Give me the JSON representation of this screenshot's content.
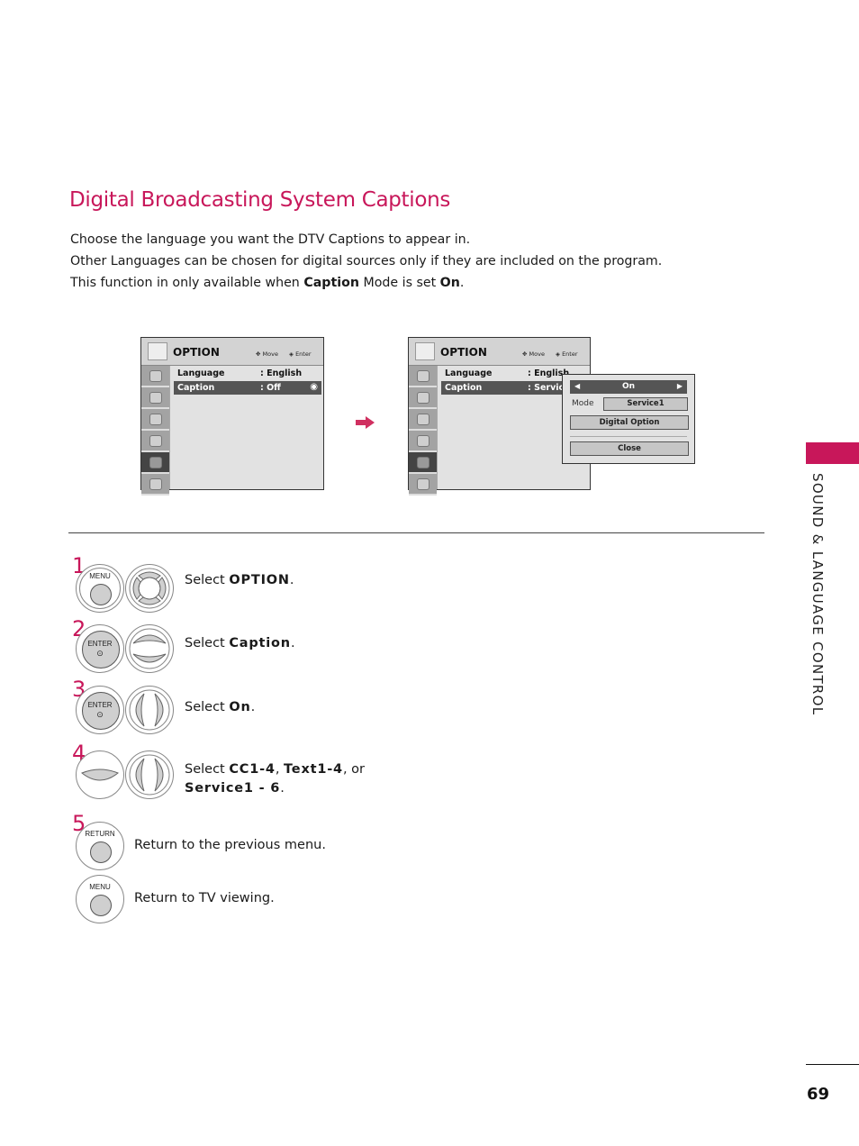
{
  "page": {
    "title": "Digital Broadcasting System Captions",
    "intro": [
      "Choose the language you want the DTV Captions to appear in.",
      "Other Languages can be chosen for digital sources only if they are included on the program."
    ],
    "intro3": {
      "a": "This function in only available when ",
      "b": "Caption",
      "c": " Mode is set ",
      "d": "On",
      "e": "."
    },
    "section_tab": "Sound & Language Control",
    "page_number": "69",
    "accent_color": "#c8175a"
  },
  "osd_left": {
    "title": "OPTION",
    "hint_move": "Move",
    "hint_enter": "Enter",
    "rows": [
      {
        "label": "Language",
        "value": ": English"
      },
      {
        "label": "Caption",
        "value": ": Off"
      }
    ]
  },
  "osd_right": {
    "title": "OPTION",
    "hint_move": "Move",
    "hint_enter": "Enter",
    "rows": [
      {
        "label": "Language",
        "value": ": English"
      },
      {
        "label": "Caption",
        "value": ": Service"
      }
    ],
    "popup": {
      "state": "On",
      "mode_label": "Mode",
      "mode_value": "Service1",
      "digital_option": "Digital Option",
      "close": "Close"
    }
  },
  "steps": [
    {
      "num": "1",
      "button": "MENU",
      "text_pre": "Select ",
      "text_bold": "OPTION",
      "text_post": "."
    },
    {
      "num": "2",
      "button": "ENTER",
      "text_pre": "Select ",
      "text_bold": "Caption",
      "text_post": "."
    },
    {
      "num": "3",
      "button": "ENTER",
      "text_pre": "Select ",
      "text_bold": "On",
      "text_post": "."
    },
    {
      "num": "4",
      "text_pre": "Select ",
      "b1": "CC1-4",
      "sep1": ", ",
      "b2": "Text1-4",
      "sep2": ", or",
      "b3": "Service1 - 6",
      "text_post": "."
    },
    {
      "num": "5",
      "button": "RETURN",
      "text": "Return to the previous menu."
    },
    {
      "button": "MENU",
      "text": "Return to TV viewing."
    }
  ]
}
